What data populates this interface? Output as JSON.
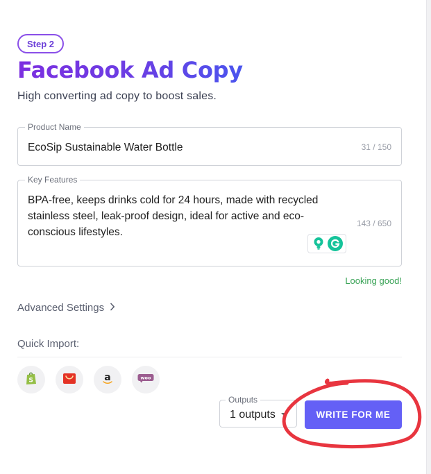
{
  "step": {
    "label": "Step 2"
  },
  "header": {
    "title": "Facebook Ad Copy",
    "subtitle": "High converting ad copy to boost sales."
  },
  "form": {
    "product_name": {
      "label": "Product Name",
      "value": "EcoSip Sustainable Water Bottle",
      "counter": "31 / 150"
    },
    "key_features": {
      "label": "Key Features",
      "value": "BPA-free, keeps drinks cold for 24 hours, made with recycled stainless steel, leak-proof design, ideal for active and eco-conscious lifestyles.",
      "counter": "143 / 650"
    },
    "status": "Looking good!",
    "assist_icons": [
      "lightbulb-icon",
      "grammarly-icon"
    ]
  },
  "advanced": {
    "label": "Advanced Settings",
    "icon": "chevron-right-icon"
  },
  "quick_import": {
    "label": "Quick Import:",
    "sources": [
      {
        "name": "shopify",
        "icon": "shopify-icon",
        "color": "#95bf47"
      },
      {
        "name": "aliexpress",
        "icon": "aliexpress-icon",
        "color": "#e43225"
      },
      {
        "name": "amazon",
        "icon": "amazon-icon",
        "color": "#222222"
      },
      {
        "name": "woocommerce",
        "icon": "woocommerce-icon",
        "color": "#9b5c8f"
      }
    ]
  },
  "outputs": {
    "label": "Outputs",
    "value": "1 outputs"
  },
  "actions": {
    "write_label": "WRITE FOR ME"
  },
  "colors": {
    "accent": "#6460f6",
    "title_gradient_start": "#7c2fe0",
    "title_gradient_end": "#4a55ee",
    "success": "#3aa357",
    "annotation": "#e8353f"
  }
}
